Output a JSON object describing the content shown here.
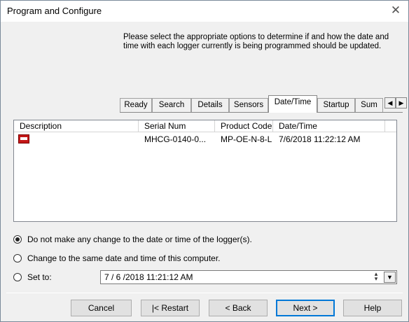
{
  "window": {
    "title": "Program and Configure",
    "close_glyph": "✕"
  },
  "instructions": "Please select the appropriate options to determine if and how the date and time with each logger currently is being programmed should be updated.",
  "tabs": [
    {
      "label": "Ready"
    },
    {
      "label": "Search"
    },
    {
      "label": "Details"
    },
    {
      "label": "Sensors"
    },
    {
      "label": "Date/Time",
      "active": true
    },
    {
      "label": "Startup"
    },
    {
      "label": "Sum"
    }
  ],
  "tab_scroll": {
    "left": "◀",
    "right": "▶"
  },
  "table": {
    "columns": [
      "Description",
      "Serial Num",
      "Product Code",
      "Date/Time"
    ],
    "rows": [
      {
        "icon": "logger-icon",
        "description": "",
        "serial": "MHCG-0140-0...",
        "product_code": "MP-OE-N-8-L",
        "datetime": "7/6/2018 11:22:12 AM"
      }
    ]
  },
  "options": {
    "no_change": "Do not make any change to the date or time of the logger(s).",
    "same_as_computer": "Change to the same date and time of this computer.",
    "set_to": "Set to:",
    "selected": "no_change"
  },
  "set_to_value": "7 / 6 /2018  11:21:12 AM",
  "buttons": {
    "cancel": "Cancel",
    "restart": "|< Restart",
    "back": "< Back",
    "next": "Next >",
    "help": "Help"
  },
  "icons": {
    "close": "close-icon",
    "logger": "logger-icon",
    "spin": "spin-icon",
    "dropdown": "chevron-down-icon"
  }
}
